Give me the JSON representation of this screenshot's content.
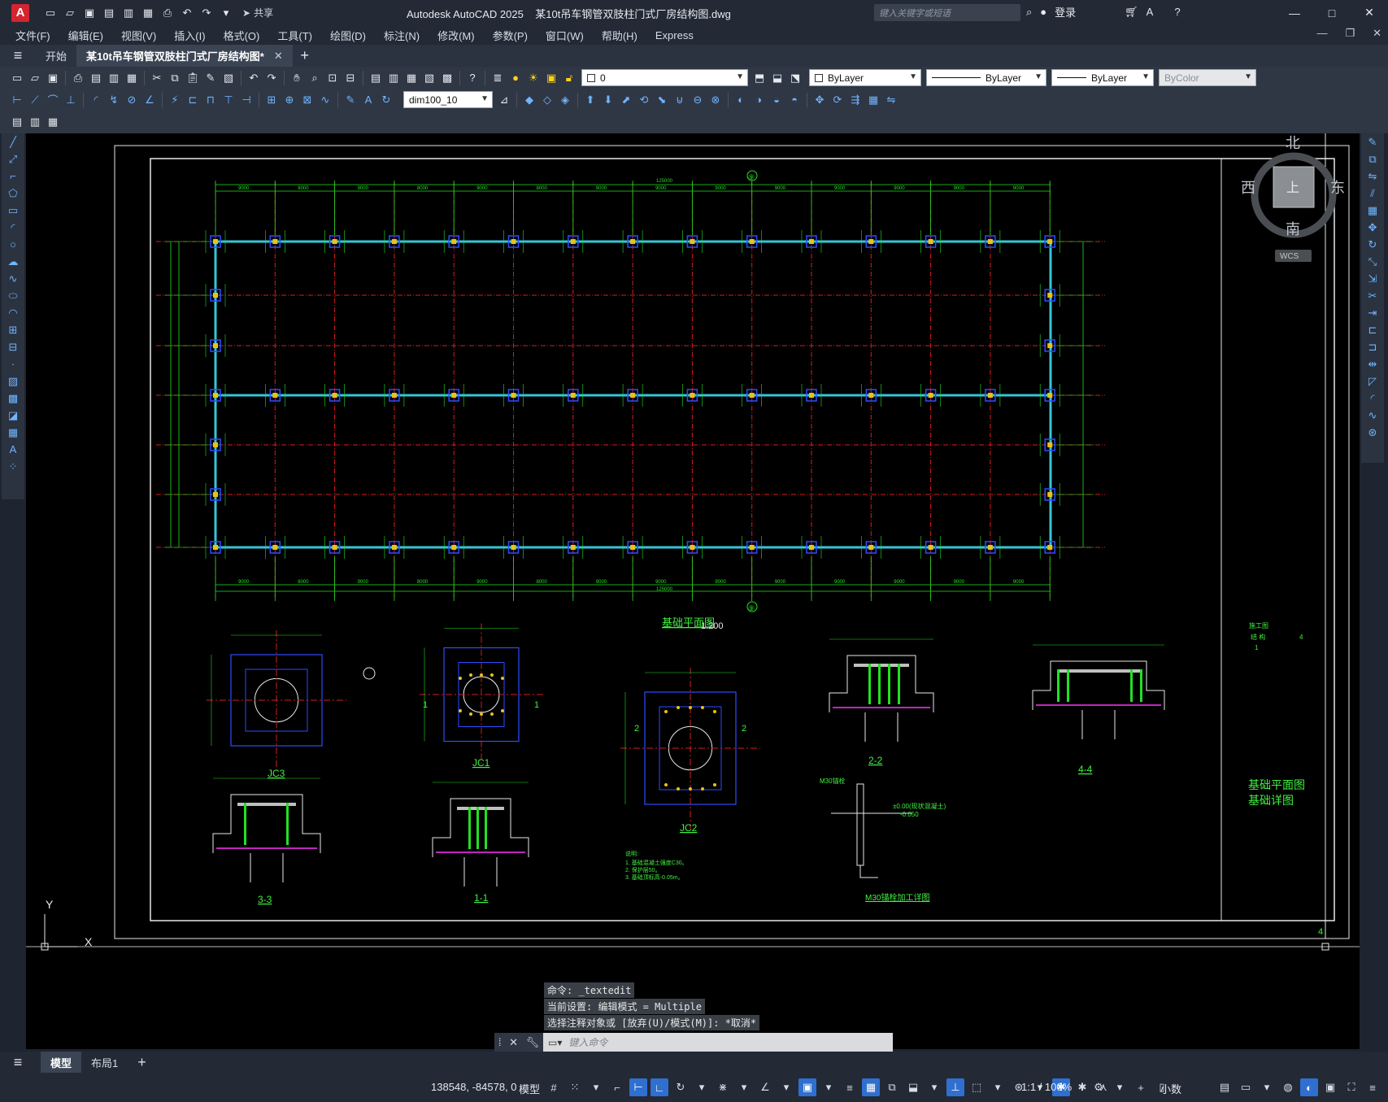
{
  "title": {
    "app_name": "Autodesk AutoCAD 2025",
    "file_name": "某10t吊车钢管双肢柱门式厂房结构图.dwg",
    "search_placeholder": "键入关键字或短语",
    "share_label": "共享",
    "login_label": "登录"
  },
  "menu": [
    "文件(F)",
    "编辑(E)",
    "视图(V)",
    "插入(I)",
    "格式(O)",
    "工具(T)",
    "绘图(D)",
    "标注(N)",
    "修改(M)",
    "参数(P)",
    "窗口(W)",
    "帮助(H)",
    "Express"
  ],
  "tabs": {
    "start": "开始",
    "active": "某10t吊车钢管双肢柱门式厂房结构图*"
  },
  "toolbar": {
    "layer_value": "0",
    "color_value": "ByLayer",
    "linetype_value": "ByLayer",
    "lineweight_value": "ByLayer",
    "plotstyle_value": "ByColor",
    "dimstyle_value": "dim100_10"
  },
  "viewcube": {
    "north": "北",
    "south": "南",
    "east": "东",
    "west": "西",
    "top": "上",
    "wcs": "WCS"
  },
  "drawing": {
    "grid_bubble_top": "⑨",
    "grid_bubble_bottom": "⑨",
    "plan_title": "基础平面图",
    "plan_scale": "1:200",
    "total_dim": "125000",
    "bay_dim_9000": "9000",
    "bay_dim_8000": "8000",
    "detail_labels": [
      "JC3",
      "JC1",
      "JC2",
      "2-2",
      "4-4",
      "3-3",
      "1-1"
    ],
    "anchor_detail_title": "M30锚栓加工详图",
    "anchor_note_1": "M30锚栓",
    "anchor_note_2": "±0.00(现状混凝土)",
    "anchor_note_3": "-0.050",
    "section_mark_1": "1",
    "section_mark_2": "2",
    "notes_title": "说明:",
    "notes": [
      "1. 基础混凝土强度C30。",
      "2. 保护层50。",
      "3. 基础顶标高-0.05m。"
    ],
    "title_block_line1": "施工图",
    "title_block_line2": "结 构",
    "title_block_num": "4",
    "title_block_num2": "1",
    "drawing_name_1": "基础平面图",
    "drawing_name_2": "基础详图",
    "sheet_num": "4",
    "ucs_y": "Y",
    "ucs_x": "X"
  },
  "command": {
    "history": [
      "命令: _textedit",
      "当前设置: 编辑模式 = Multiple",
      "选择注释对象或 [放弃(U)/模式(M)]: *取消*"
    ],
    "placeholder": "键入命令"
  },
  "layout_tabs": [
    "模型",
    "布局1"
  ],
  "status": {
    "coords": "138548, -84578, 0",
    "model": "模型",
    "scale": "1:1 / 100%",
    "units": "小数"
  },
  "colors": {
    "gridline_red": "#d41e1e",
    "dim_green": "#22e022",
    "beam_cyan": "#35c6d6",
    "column_yellow": "#e8c21a",
    "foot_blue": "#2c4dff",
    "text_green": "#3ff23f"
  }
}
